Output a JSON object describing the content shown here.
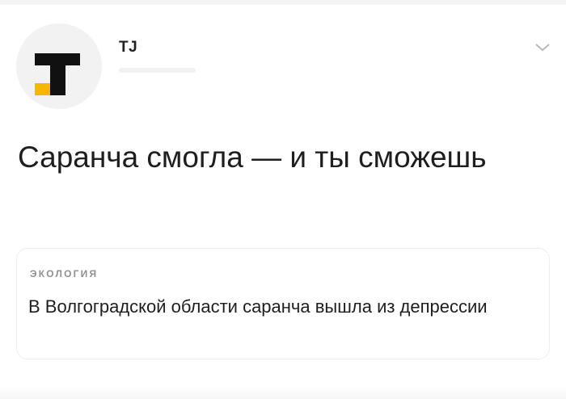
{
  "author": {
    "name": "TJ",
    "logo_icon": "tj-logo-icon",
    "accent_color": "#f5b700"
  },
  "post": {
    "title": "Саранча смогла — и ты сможешь"
  },
  "link_card": {
    "category": "ЭКОЛОГИЯ",
    "title": "В Волгоградской области саранча вышла из депрессии"
  },
  "icons": {
    "menu": "chevron-down-icon"
  }
}
